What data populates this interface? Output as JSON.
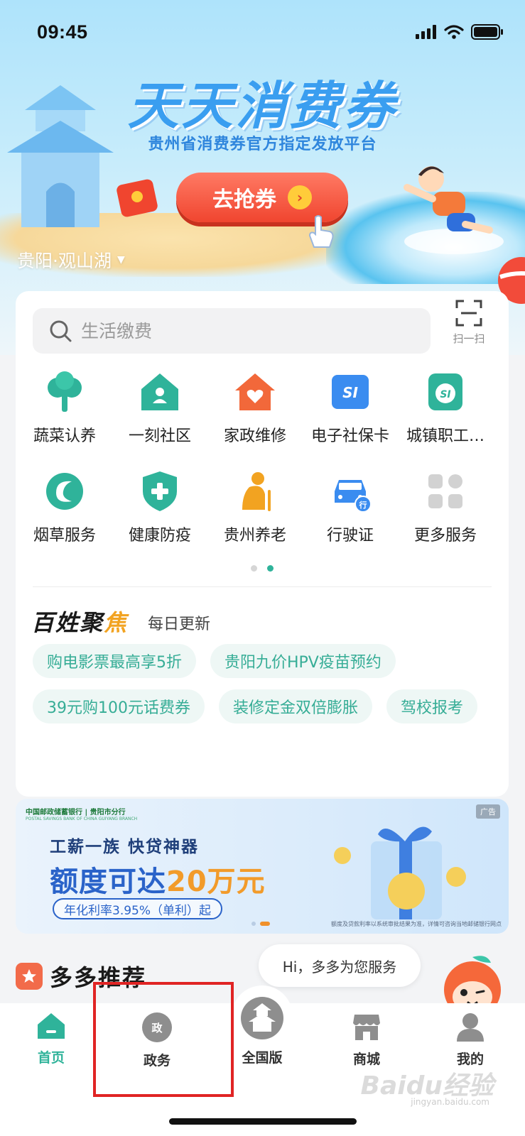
{
  "status_bar": {
    "time": "09:45"
  },
  "hero": {
    "title": "天天消费券",
    "subtitle": "贵州省消费券官方指定发放平台",
    "cta_label": "去抢券",
    "location": "贵阳·观山湖"
  },
  "search": {
    "placeholder": "生活缴费"
  },
  "scan": {
    "label": "扫一扫"
  },
  "services": {
    "row1": [
      {
        "label": "蔬菜认养",
        "icon": "tree-icon",
        "color": "#2fb39a"
      },
      {
        "label": "一刻社区",
        "icon": "community-house-icon",
        "color": "#2fb39a"
      },
      {
        "label": "家政维修",
        "icon": "home-heart-icon",
        "color": "#f2683a"
      },
      {
        "label": "电子社保卡",
        "icon": "social-security-card-icon",
        "color": "#3a8cf0"
      },
      {
        "label": "城镇职工…",
        "icon": "worker-insurance-icon",
        "color": "#2fb39a"
      }
    ],
    "row2": [
      {
        "label": "烟草服务",
        "icon": "tobacco-icon",
        "color": "#2fb39a"
      },
      {
        "label": "健康防疫",
        "icon": "shield-plus-icon",
        "color": "#2fb39a"
      },
      {
        "label": "贵州养老",
        "icon": "elderly-icon",
        "color": "#f2a321"
      },
      {
        "label": "行驶证",
        "icon": "car-license-icon",
        "color": "#3a8cf0"
      },
      {
        "label": "更多服务",
        "icon": "more-grid-icon",
        "color": "#cfcfcf"
      }
    ]
  },
  "pager": {
    "pages": 2,
    "active_index": 1
  },
  "focus": {
    "title_main": "百姓聚",
    "title_accent": "焦",
    "subtitle": "每日更新",
    "tags": [
      "购电影票最高享5折",
      "贵阳九价HPV疫苗预约",
      "39元购100元话费券",
      "装修定金双倍膨胀",
      "驾校报考"
    ]
  },
  "ad": {
    "bank_name": "中国邮政储蓄银行",
    "bank_en": "POSTAL SAVINGS BANK OF CHINA",
    "branch": "贵阳市分行",
    "branch_en": "GUIYANG BRANCH",
    "badge": "广告",
    "line1": "工薪一族  快贷神器",
    "line2_main": "额度可达",
    "line2_accent": "20万元",
    "line3": "年化利率3.95%（单利）起",
    "note": "额度及贷款利率以系统审批结果为准，详情可咨询当地邮储银行网点"
  },
  "recommend": {
    "title": "多多推荐"
  },
  "assistant": {
    "greeting": "Hi，多多为您服务"
  },
  "tabbar": {
    "items": [
      {
        "label": "首页",
        "icon": "home-icon",
        "active": true
      },
      {
        "label": "政务",
        "icon": "government-affairs-icon",
        "active": false
      },
      {
        "label": "全国版",
        "icon": "pagoda-icon",
        "active": false
      },
      {
        "label": "商城",
        "icon": "store-icon",
        "active": false
      },
      {
        "label": "我的",
        "icon": "profile-icon",
        "active": false
      }
    ]
  },
  "watermark": {
    "text": "Baidu经验",
    "url_text": "jingyan.baidu.com"
  },
  "colors": {
    "accent": "#2fb39a",
    "cta": "#f0452f",
    "highlight_box": "#e02424"
  }
}
